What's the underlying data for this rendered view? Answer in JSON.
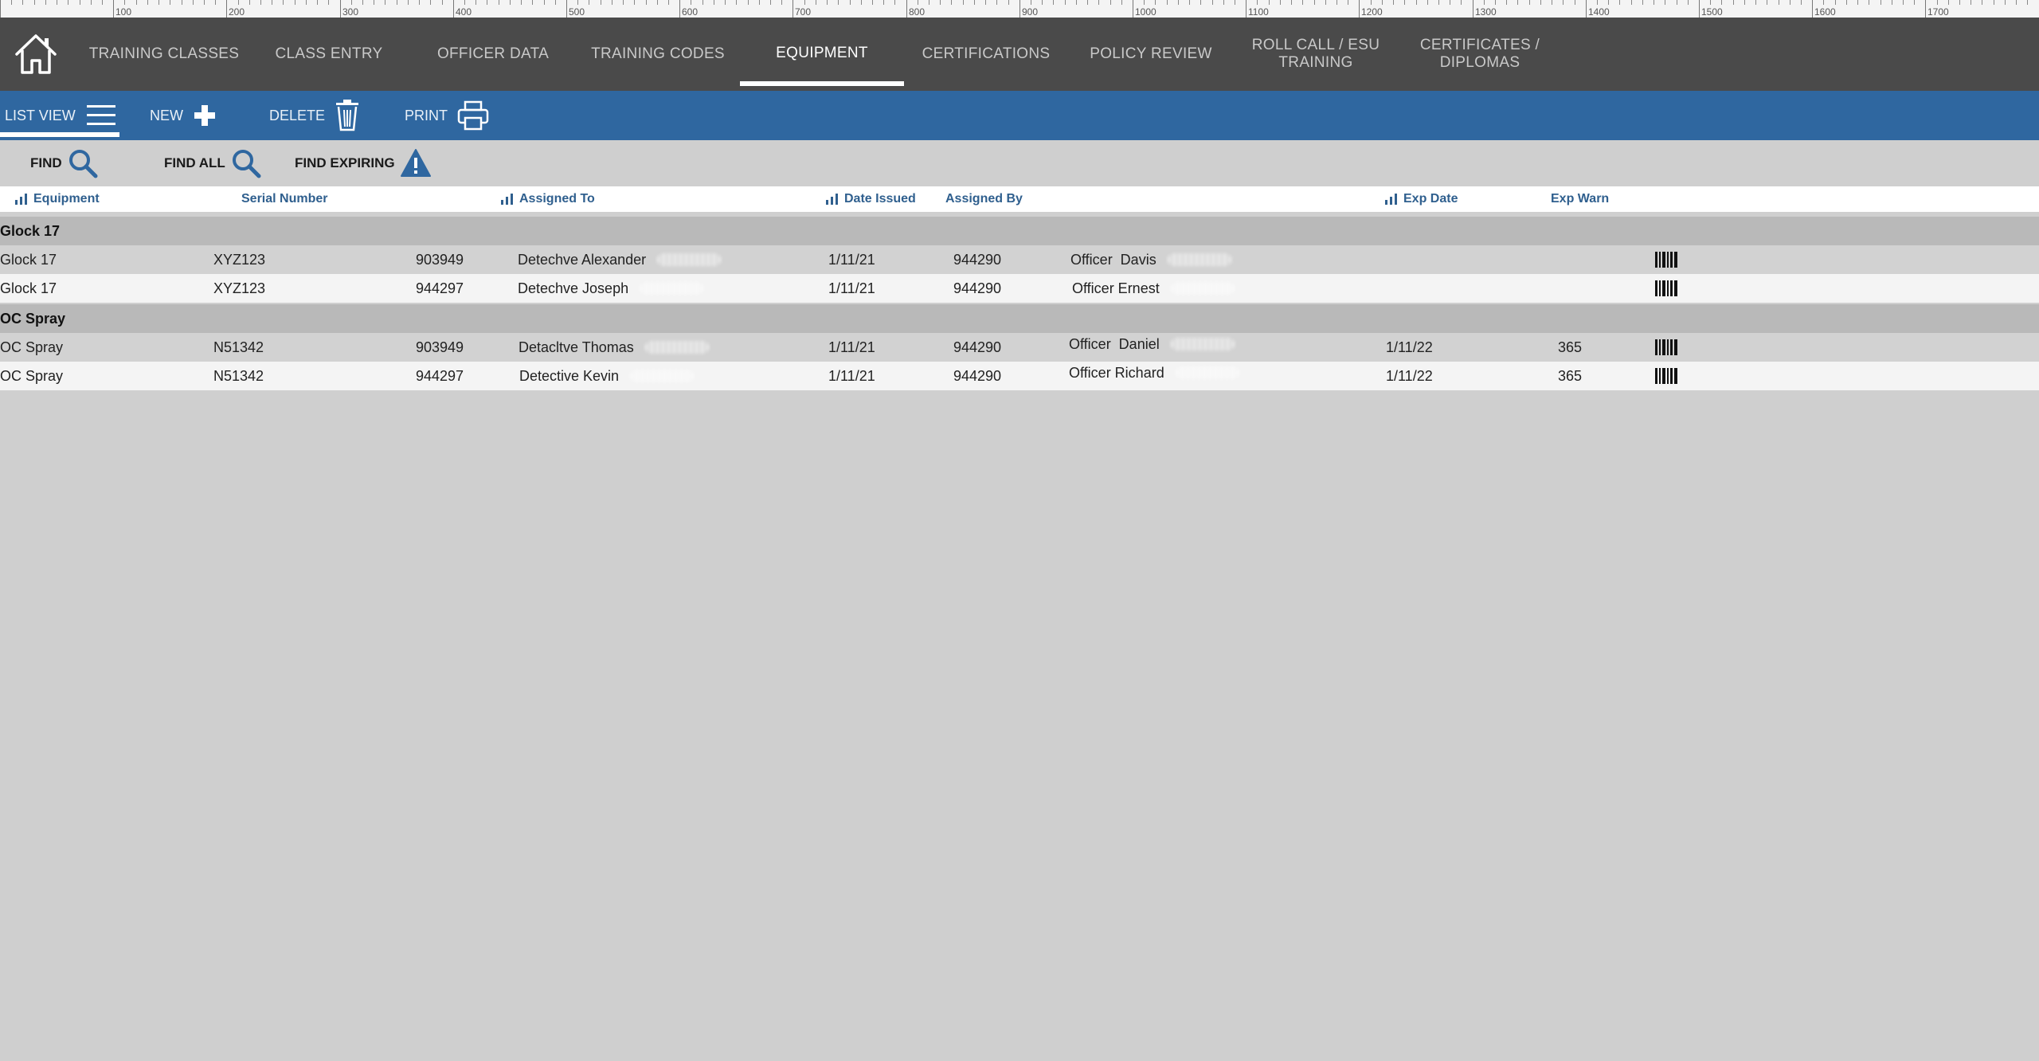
{
  "ruler": {
    "labels": [
      "100",
      "200",
      "300",
      "400",
      "500",
      "600",
      "700",
      "800",
      "900",
      "1000",
      "1100",
      "1200",
      "1300",
      "1400",
      "1500",
      "1600",
      "1700"
    ]
  },
  "nav": {
    "tabs": [
      {
        "label": "TRAINING CLASSES"
      },
      {
        "label": "CLASS ENTRY"
      },
      {
        "label": "OFFICER DATA"
      },
      {
        "label": "TRAINING CODES"
      },
      {
        "label": "EQUIPMENT"
      },
      {
        "label": "CERTIFICATIONS"
      },
      {
        "label": "POLICY REVIEW"
      },
      {
        "label": "ROLL CALL / ESU\nTRAINING"
      },
      {
        "label": "CERTIFICATES /\nDIPLOMAS"
      }
    ],
    "active_tab": "EQUIPMENT"
  },
  "toolbar": {
    "list_view": "LIST VIEW",
    "new": "NEW",
    "delete": "DELETE",
    "print": "PRINT"
  },
  "find": {
    "find": "FIND",
    "find_all": "FIND ALL",
    "find_expiring": "FIND EXPIRING"
  },
  "columns": {
    "equipment": "Equipment",
    "serial_number": "Serial Number",
    "assigned_to": "Assigned To",
    "date_issued": "Date Issued",
    "assigned_by": "Assigned By",
    "exp_date": "Exp Date",
    "exp_warn": "Exp Warn"
  },
  "groups": [
    {
      "name": "Glock 17",
      "rows": [
        {
          "equipment": "Glock 17",
          "serial": "XYZ123",
          "assigned_to_id": "903949",
          "assigned_to": "Detechve Alexander",
          "date_issued": "1/11/21",
          "assigned_by_id": "944290",
          "assigned_by": "Officer  Davis",
          "exp_date": "",
          "exp_warn": ""
        },
        {
          "equipment": "Glock 17",
          "serial": "XYZ123",
          "assigned_to_id": "944297",
          "assigned_to": "Detechve Joseph",
          "date_issued": "1/11/21",
          "assigned_by_id": "944290",
          "assigned_by": "Officer Ernest",
          "exp_date": "",
          "exp_warn": ""
        }
      ]
    },
    {
      "name": "OC Spray",
      "rows": [
        {
          "equipment": "OC Spray",
          "serial": "N51342",
          "assigned_to_id": "903949",
          "assigned_to": "Detacltve Thomas",
          "date_issued": "1/11/21",
          "assigned_by_id": "944290",
          "assigned_by": "Officer  Daniel",
          "exp_date": "1/11/22",
          "exp_warn": "365"
        },
        {
          "equipment": "OC Spray",
          "serial": "N51342",
          "assigned_to_id": "944297",
          "assigned_to": "Detective Kevin",
          "date_issued": "1/11/21",
          "assigned_by_id": "944290",
          "assigned_by": "Officer Richard",
          "exp_date": "1/11/22",
          "exp_warn": "365"
        }
      ]
    }
  ],
  "colors": {
    "nav_bg": "#4a4a4a",
    "toolbar_bg": "#2f67a0",
    "header_text": "#2f5f8e",
    "page_bg": "#cfcfcf",
    "group_bg": "#b9b9b9"
  }
}
